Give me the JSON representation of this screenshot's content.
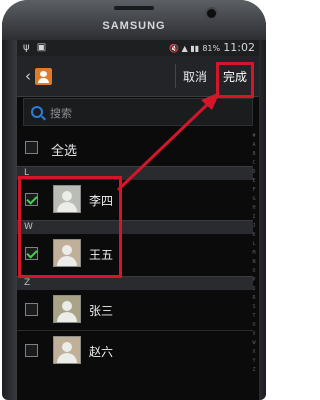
{
  "device": {
    "brand": "SAMSUNG"
  },
  "statusbar": {
    "left_icons": "ψ  ▣",
    "right_icons": "🔇 ▲ ▮▮",
    "battery": "81%",
    "time": "11:02"
  },
  "actionbar": {
    "cancel_label": "取消",
    "done_label": "完成"
  },
  "search": {
    "placeholder": "搜索"
  },
  "select_all": {
    "label": "全选",
    "checked": false
  },
  "sections": [
    {
      "letter": "L",
      "contacts": [
        {
          "name": "李四",
          "checked": true
        }
      ]
    },
    {
      "letter": "W",
      "contacts": [
        {
          "name": "王五",
          "checked": true
        }
      ]
    },
    {
      "letter": "Z",
      "contacts": [
        {
          "name": "张三",
          "checked": false
        },
        {
          "name": "赵六",
          "checked": false
        }
      ]
    }
  ],
  "index_letters": [
    "#",
    "A",
    "B",
    "C",
    "D",
    "E",
    "F",
    "G",
    "H",
    "I",
    "J",
    "K",
    "L",
    "M",
    "N",
    "O",
    "P",
    "Q",
    "R",
    "S",
    "T",
    "U",
    "V",
    "W",
    "X",
    "Y",
    "Z"
  ],
  "colors": {
    "highlight": "#d3162a",
    "check": "#42d34a",
    "accent": "#2b7de0"
  }
}
